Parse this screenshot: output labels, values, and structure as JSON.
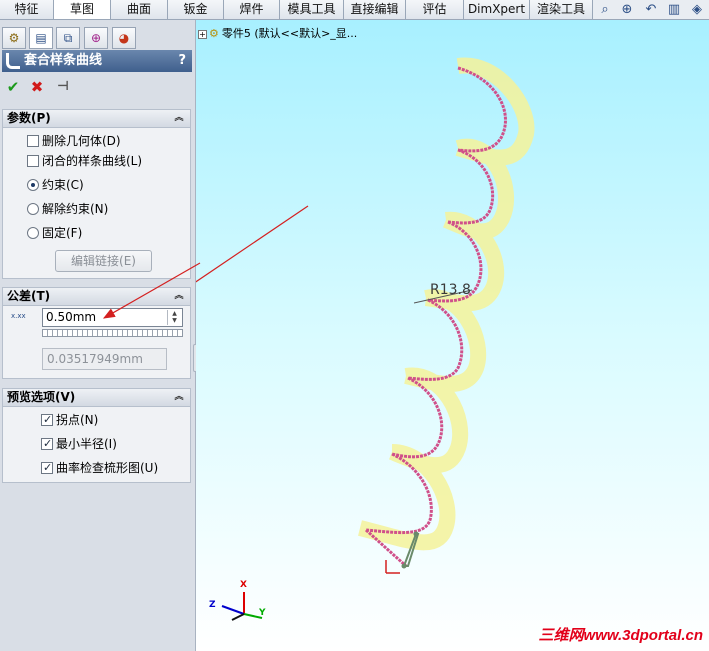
{
  "tabs": [
    {
      "label": "特征",
      "active": false
    },
    {
      "label": "草图",
      "active": true
    },
    {
      "label": "曲面",
      "active": false
    },
    {
      "label": "钣金",
      "active": false
    },
    {
      "label": "焊件",
      "active": false
    },
    {
      "label": "模具工具",
      "active": false
    },
    {
      "label": "直接编辑",
      "active": false
    },
    {
      "label": "评估",
      "active": false
    },
    {
      "label": "DimXpert",
      "active": false
    },
    {
      "label": "渲染工具",
      "active": false
    }
  ],
  "view_tools": [
    "zoom-to-fit-icon",
    "zoom-area-icon",
    "previous-view-icon",
    "section-view-icon",
    "view-orientation-icon"
  ],
  "panel": {
    "title": "套合样条曲线",
    "help": "?",
    "actions": [
      "ok-icon",
      "cancel-icon",
      "pushpin-icon"
    ]
  },
  "params": {
    "header": "参数(P)",
    "delete_geometry": {
      "label": "删除几何体(D)",
      "checked": false
    },
    "closed_spline": {
      "label": "闭合的样条曲线(L)",
      "checked": false
    },
    "constraint_options": [
      {
        "label": "约束(C)",
        "selected": true
      },
      {
        "label": "解除约束(N)",
        "selected": false
      },
      {
        "label": "固定(F)",
        "selected": false
      }
    ],
    "edit_link_button": "编辑链接(E)"
  },
  "tolerance": {
    "header": "公差(T)",
    "icon_text": "x.xx",
    "value": "0.50mm",
    "result": "0.03517949mm"
  },
  "preview": {
    "header": "预览选项(V)",
    "options": [
      {
        "label": "拐点(N)",
        "checked": true
      },
      {
        "label": "最小半径(I)",
        "checked": true
      },
      {
        "label": "曲率检查梳形图(U)",
        "checked": true
      }
    ]
  },
  "viewport": {
    "tree_node": "零件5  (默认<<默认>_显...",
    "radius_label": "R13.8",
    "watermark": "三维网www.3dportal.cn",
    "triad": {
      "x": "X",
      "y": "Y",
      "z": "Z"
    },
    "background_top": "#a8f0ff",
    "background_bottom": "#ffffff",
    "spline_color": "#d0508a",
    "comb_color": "#f4f29a",
    "arrow_color": "#d42020"
  }
}
